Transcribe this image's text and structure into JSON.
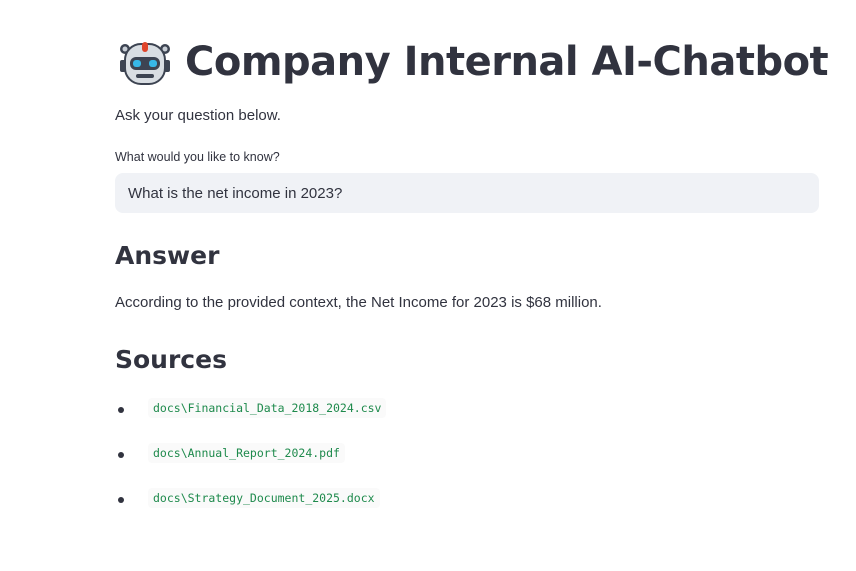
{
  "header": {
    "icon": "robot-icon",
    "title": "Company Internal AI-Chatbot"
  },
  "intro": {
    "subtitle": "Ask your question below."
  },
  "query": {
    "label": "What would you like to know?",
    "value": "What is the net income in 2023?"
  },
  "answer": {
    "heading": "Answer",
    "text": "According to the provided context, the Net Income for 2023 is $68 million."
  },
  "sources": {
    "heading": "Sources",
    "items": [
      "docs\\Financial_Data_2018_2024.csv",
      "docs\\Annual_Report_2024.pdf",
      "docs\\Strategy_Document_2025.docx"
    ]
  },
  "colors": {
    "text": "#31333f",
    "input_bg": "#f0f2f6",
    "code_text": "#1e8a4c"
  }
}
